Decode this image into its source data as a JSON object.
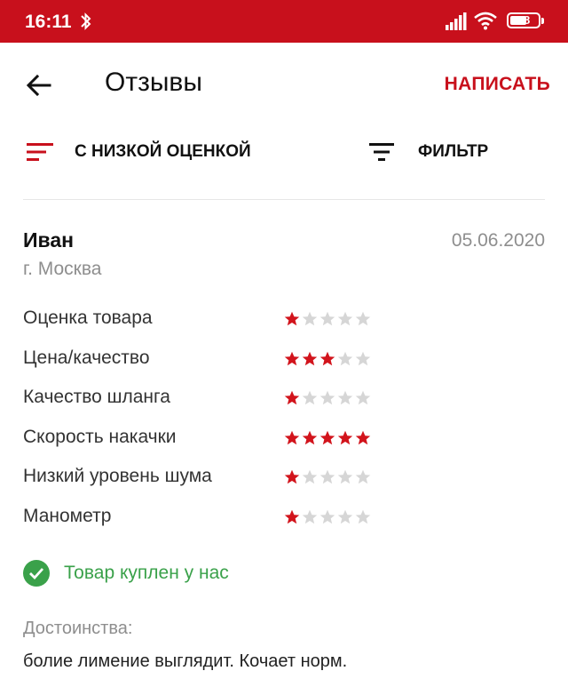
{
  "status_bar": {
    "time": "16:11",
    "battery": "48"
  },
  "header": {
    "title": "Отзывы",
    "write_label": "НАПИСАТЬ"
  },
  "filters": {
    "sort_label": "С НИЗКОЙ ОЦЕНКОЙ",
    "filter_label": "ФИЛЬТР"
  },
  "review": {
    "author": "Иван",
    "date": "05.06.2020",
    "city": "г. Москва",
    "ratings": [
      {
        "label": "Оценка товара",
        "stars": 1,
        "max": 5
      },
      {
        "label": "Цена/качество",
        "stars": 3,
        "max": 5
      },
      {
        "label": "Качество шланга",
        "stars": 1,
        "max": 5
      },
      {
        "label": "Скорость накачки",
        "stars": 5,
        "max": 5
      },
      {
        "label": "Низкий уровень шума",
        "stars": 1,
        "max": 5
      },
      {
        "label": "Манометр",
        "stars": 1,
        "max": 5
      }
    ],
    "purchased_text": "Товар куплен у нас",
    "pros_label": "Достоинства:",
    "pros_text": "болие лимение выглядит. Кочает норм."
  },
  "colors": {
    "accent": "#c8101c",
    "star_filled": "#d2141c",
    "star_empty": "#d6d6d6",
    "verified": "#3aa14a",
    "muted_text": "#8e8e8e"
  },
  "icons": {
    "back": "arrow-left-icon",
    "sort": "sort-icon",
    "filter": "filter-icon",
    "verified": "check-circle-icon"
  }
}
